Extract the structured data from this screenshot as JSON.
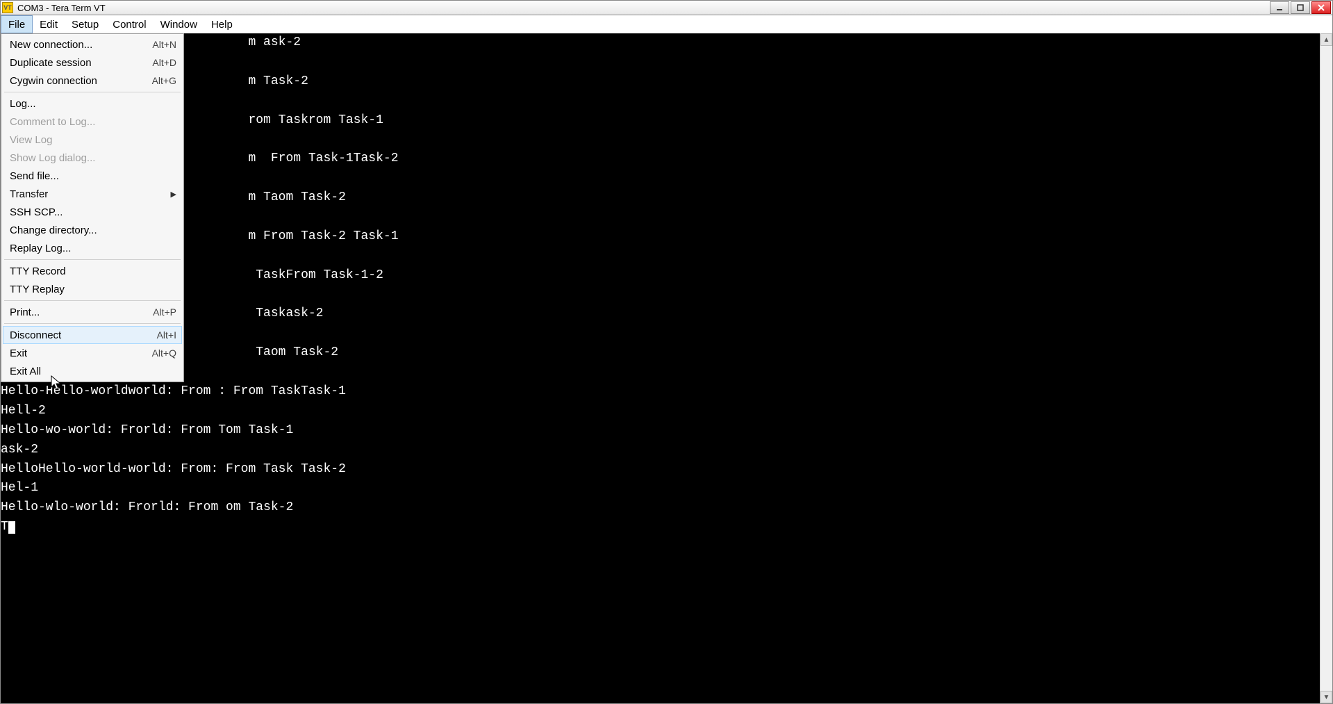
{
  "window": {
    "icon_text": "VT",
    "title": "COM3 - Tera Term VT"
  },
  "menubar": [
    "File",
    "Edit",
    "Setup",
    "Control",
    "Window",
    "Help"
  ],
  "active_menu_index": 0,
  "file_menu": [
    {
      "type": "item",
      "label": "New connection...",
      "shortcut": "Alt+N",
      "enabled": true
    },
    {
      "type": "item",
      "label": "Duplicate session",
      "shortcut": "Alt+D",
      "enabled": true
    },
    {
      "type": "item",
      "label": "Cygwin connection",
      "shortcut": "Alt+G",
      "enabled": true
    },
    {
      "type": "sep"
    },
    {
      "type": "item",
      "label": "Log...",
      "shortcut": "",
      "enabled": true
    },
    {
      "type": "item",
      "label": "Comment to Log...",
      "shortcut": "",
      "enabled": false
    },
    {
      "type": "item",
      "label": "View Log",
      "shortcut": "",
      "enabled": false
    },
    {
      "type": "item",
      "label": "Show Log dialog...",
      "shortcut": "",
      "enabled": false
    },
    {
      "type": "item",
      "label": "Send file...",
      "shortcut": "",
      "enabled": true
    },
    {
      "type": "submenu",
      "label": "Transfer",
      "shortcut": "",
      "enabled": true
    },
    {
      "type": "item",
      "label": "SSH SCP...",
      "shortcut": "",
      "enabled": true
    },
    {
      "type": "item",
      "label": "Change directory...",
      "shortcut": "",
      "enabled": true
    },
    {
      "type": "item",
      "label": "Replay Log...",
      "shortcut": "",
      "enabled": true
    },
    {
      "type": "sep"
    },
    {
      "type": "item",
      "label": "TTY Record",
      "shortcut": "",
      "enabled": true
    },
    {
      "type": "item",
      "label": "TTY Replay",
      "shortcut": "",
      "enabled": true
    },
    {
      "type": "sep"
    },
    {
      "type": "item",
      "label": "Print...",
      "shortcut": "Alt+P",
      "enabled": true
    },
    {
      "type": "sep"
    },
    {
      "type": "item",
      "label": "Disconnect",
      "shortcut": "Alt+I",
      "enabled": true,
      "hover": true
    },
    {
      "type": "item",
      "label": "Exit",
      "shortcut": "Alt+Q",
      "enabled": true
    },
    {
      "type": "item",
      "label": "Exit All",
      "shortcut": "",
      "enabled": true
    }
  ],
  "terminal_lines": [
    "                                 m ask-2",
    "",
    "                                 m Task-2",
    "",
    "                                 rom Taskrom Task-1",
    "",
    "                                 m  From Task-1Task-2",
    "",
    "                                 m Taom Task-2",
    "",
    "                                 m From Task-2 Task-1",
    "",
    "                                  TaskFrom Task-1-2",
    "",
    "                                  Taskask-2",
    "",
    "                                  Taom Task-2",
    "",
    "Hello-Hello-worldworld: From : From TaskTask-1",
    "Hell-2",
    "Hello-wo-world: Frorld: From Tom Task-1",
    "ask-2",
    "HelloHello-world-world: From: From Task Task-2",
    "Hel-1",
    "Hello-wlo-world: Frorld: From om Task-2",
    "T"
  ]
}
